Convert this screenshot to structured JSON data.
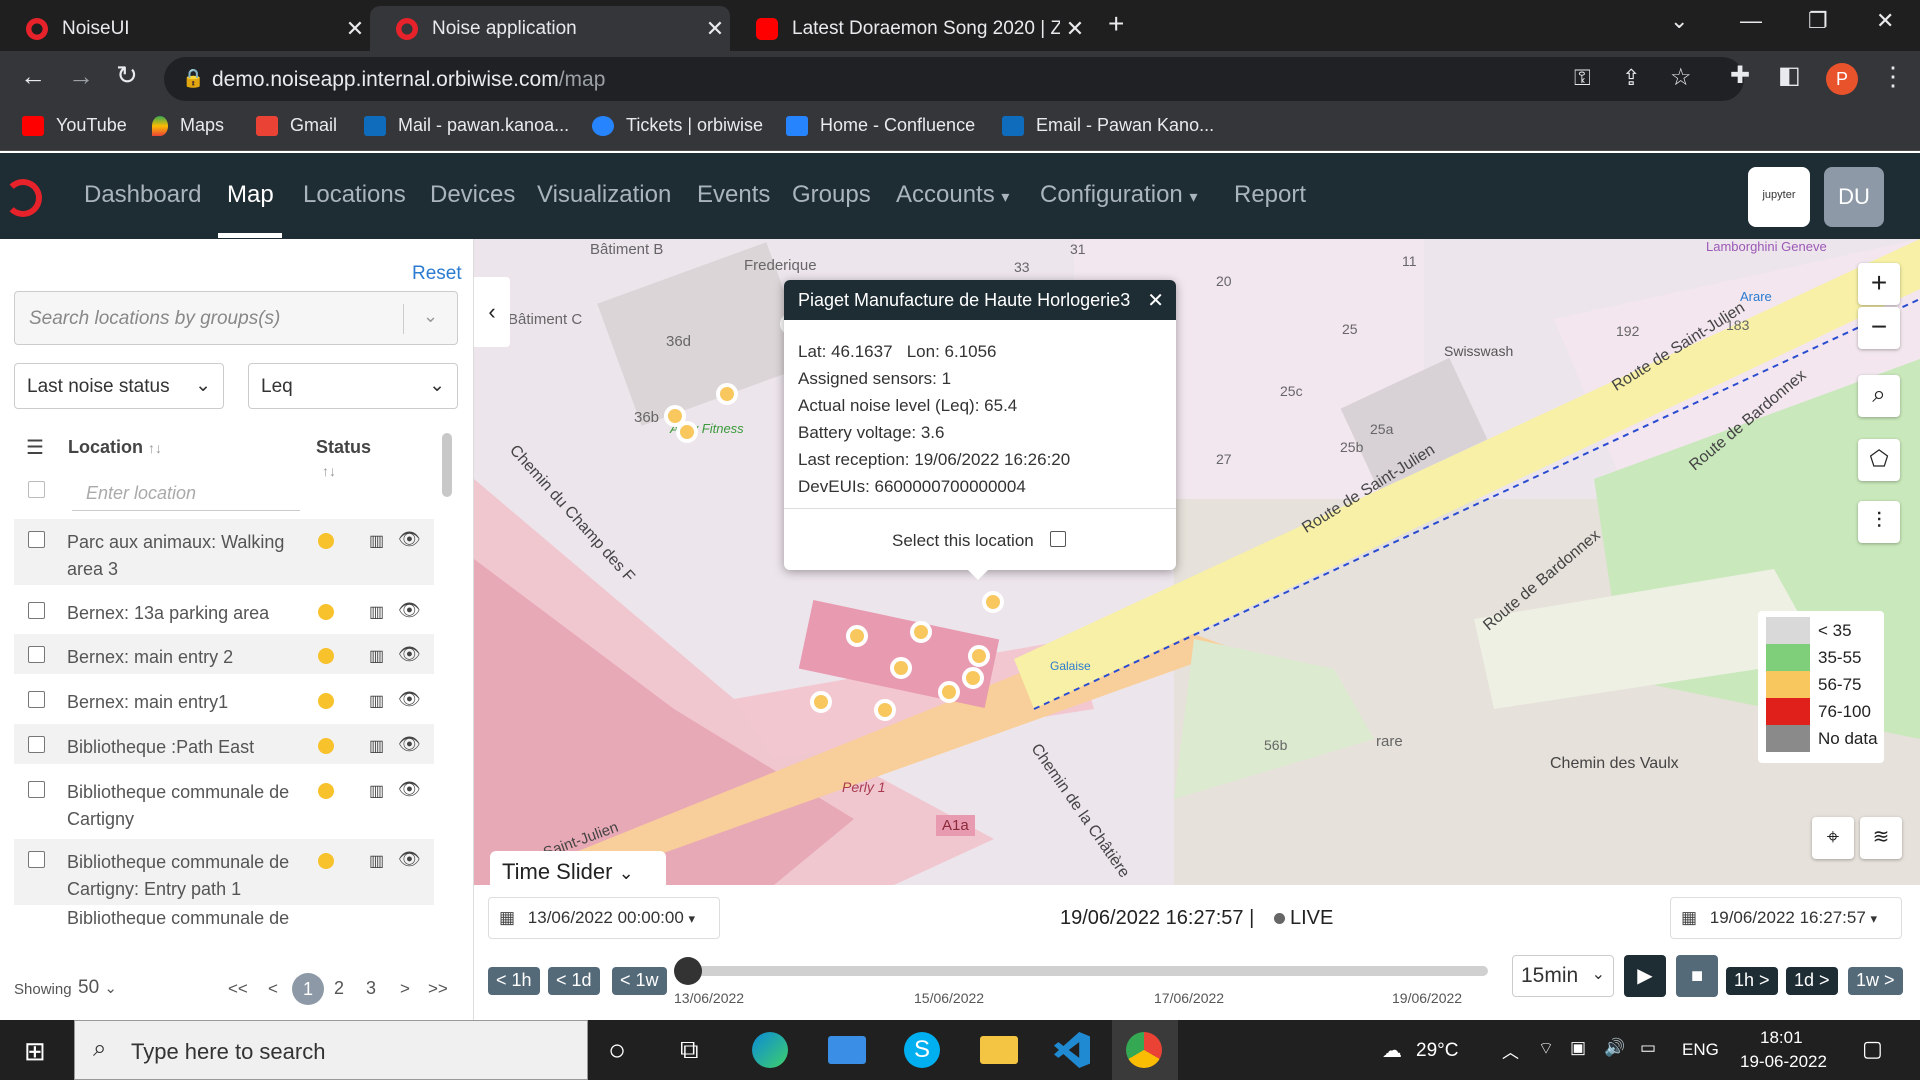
{
  "browser": {
    "tabs": [
      {
        "title": "NoiseUI",
        "active": false
      },
      {
        "title": "Noise application",
        "active": true
      },
      {
        "title": "Latest Doraemon Song 2020 | Zin",
        "active": false
      }
    ],
    "new_tab": "+",
    "url_host": "demo.noiseapp.internal.orbiwise.com",
    "url_path": "/map",
    "profile_initial": "P",
    "bookmarks": [
      "YouTube",
      "Maps",
      "Gmail",
      "Mail - pawan.kanoa...",
      "Tickets | orbiwise",
      "Home - Confluence",
      "Email - Pawan Kano..."
    ]
  },
  "app_nav": {
    "items": [
      "Dashboard",
      "Map",
      "Locations",
      "Devices",
      "Visualization",
      "Events",
      "Groups",
      "Accounts",
      "Configuration",
      "Report"
    ],
    "active": "Map",
    "jupyter_label": "jupyter",
    "user_initials": "DU"
  },
  "sidebar": {
    "reset": "Reset",
    "search_placeholder": "Search locations by groups(s)",
    "filter_status": "Last noise status",
    "filter_metric": "Leq",
    "col_location": "Location",
    "col_status": "Status",
    "location_placeholder": "Enter location",
    "rows": [
      "Parc aux animaux: Walking area 3",
      "Bernex: 13a parking area",
      "Bernex: main entry 2",
      "Bernex: main entry1",
      "Bibliotheque :Path East",
      "Bibliotheque communale de Cartigny",
      "Bibliotheque communale de Cartigny: Entry path 1",
      "Bibliotheque communale de"
    ],
    "showing_label": "Showing",
    "showing_value": "50",
    "pages": [
      "<<",
      "<",
      "1",
      "2",
      "3",
      ">",
      ">>"
    ],
    "current_page": "1"
  },
  "popup": {
    "title": "Piaget Manufacture de Haute Horlogerie3",
    "lat": "Lat: 46.1637",
    "lon": "Lon: 6.1056",
    "assigned": "Assigned sensors: 1",
    "noise": "Actual noise level (Leq): 65.4",
    "battery": "Battery voltage: 3.6",
    "last_reception": "Last reception: 19/06/2022 16:26:20",
    "deveuis": "DevEUIs: 6600000700000004",
    "select": "Select this location"
  },
  "legend": [
    {
      "label": "< 35",
      "color": "#d9d9d9"
    },
    {
      "label": "35-55",
      "color": "#7fcf7a"
    },
    {
      "label": "56-75",
      "color": "#f8c85e"
    },
    {
      "label": "76-100",
      "color": "#e0201b"
    },
    {
      "label": "No data",
      "color": "#8a8a8a"
    }
  ],
  "map_labels": [
    "Bâtiment B",
    "Frederique",
    "Bâtiment C",
    "36d",
    "36b",
    "Activ Fitness",
    "Chemin du Champ des F",
    "Route de Saint-Julien",
    "Route de Saint-Julien",
    "Route de Bardonnex",
    "Route de Bardonnex",
    "Swisswash",
    "Arare",
    "Lamborghini Geneve",
    "Chemin des Vaulx",
    "Chemin de la Châtière",
    "Galaise",
    "Perly 1",
    "A1a",
    "Saint-Julien",
    "25",
    "25c",
    "25a",
    "25b",
    "27",
    "20",
    "33",
    "31",
    "11",
    "192",
    "183",
    "rare",
    "56b"
  ],
  "timebar": {
    "slider_label": "Time Slider",
    "start": "13/06/2022 00:00:00",
    "now": "19/06/2022 16:27:57 |",
    "live": "LIVE",
    "end": "19/06/2022 16:27:57",
    "back_steps": [
      "< 1h",
      "< 1d",
      "< 1w"
    ],
    "fwd_steps": [
      "1h >",
      "1d >",
      "1w >"
    ],
    "interval": "15min",
    "ticks": [
      "13/06/2022",
      "15/06/2022",
      "17/06/2022",
      "19/06/2022"
    ]
  },
  "taskbar": {
    "search": "Type here to search",
    "weather": "29°C",
    "lang": "ENG",
    "time": "18:01",
    "date": "19-06-2022"
  }
}
